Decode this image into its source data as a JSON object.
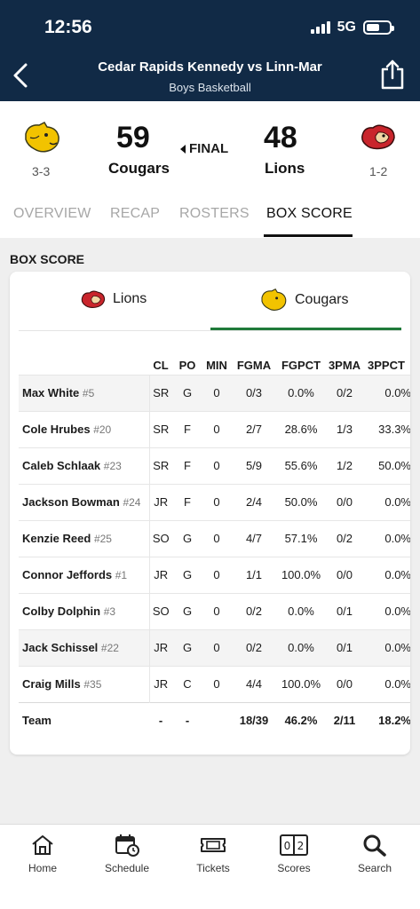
{
  "status_bar": {
    "time": "12:56",
    "network": "5G"
  },
  "header": {
    "title": "Cedar Rapids Kennedy vs Linn-Mar",
    "subtitle": "Boys Basketball"
  },
  "game": {
    "home": {
      "name": "Cougars",
      "score": "59",
      "record": "3-3"
    },
    "away": {
      "name": "Lions",
      "score": "48",
      "record": "1-2"
    },
    "status": "FINAL"
  },
  "tabs": [
    "OVERVIEW",
    "RECAP",
    "ROSTERS",
    "BOX SCORE"
  ],
  "box_score": {
    "section_title": "BOX SCORE",
    "team_tabs": [
      "Lions",
      "Cougars"
    ],
    "active_team": "Cougars",
    "columns": [
      "CL",
      "PO",
      "MIN",
      "FGMA",
      "FGPCT",
      "3PMA",
      "3PPCT"
    ],
    "players": [
      {
        "name": "Max White",
        "number": "#5",
        "cl": "SR",
        "po": "G",
        "min": "0",
        "fgma": "0/3",
        "fgpct": "0.0%",
        "tpma": "0/2",
        "tppct": "0.0%"
      },
      {
        "name": "Cole Hrubes",
        "number": "#20",
        "cl": "SR",
        "po": "F",
        "min": "0",
        "fgma": "2/7",
        "fgpct": "28.6%",
        "tpma": "1/3",
        "tppct": "33.3%"
      },
      {
        "name": "Caleb Schlaak",
        "number": "#23",
        "cl": "SR",
        "po": "F",
        "min": "0",
        "fgma": "5/9",
        "fgpct": "55.6%",
        "tpma": "1/2",
        "tppct": "50.0%"
      },
      {
        "name": "Jackson Bowman",
        "number": "#24",
        "cl": "JR",
        "po": "F",
        "min": "0",
        "fgma": "2/4",
        "fgpct": "50.0%",
        "tpma": "0/0",
        "tppct": "0.0%"
      },
      {
        "name": "Kenzie Reed",
        "number": "#25",
        "cl": "SO",
        "po": "G",
        "min": "0",
        "fgma": "4/7",
        "fgpct": "57.1%",
        "tpma": "0/2",
        "tppct": "0.0%"
      },
      {
        "name": "Connor Jeffords",
        "number": "#1",
        "cl": "JR",
        "po": "G",
        "min": "0",
        "fgma": "1/1",
        "fgpct": "100.0%",
        "tpma": "0/0",
        "tppct": "0.0%"
      },
      {
        "name": "Colby Dolphin",
        "number": "#3",
        "cl": "SO",
        "po": "G",
        "min": "0",
        "fgma": "0/2",
        "fgpct": "0.0%",
        "tpma": "0/1",
        "tppct": "0.0%"
      },
      {
        "name": "Jack Schissel",
        "number": "#22",
        "cl": "JR",
        "po": "G",
        "min": "0",
        "fgma": "0/2",
        "fgpct": "0.0%",
        "tpma": "0/1",
        "tppct": "0.0%"
      },
      {
        "name": "Craig Mills",
        "number": "#35",
        "cl": "JR",
        "po": "C",
        "min": "0",
        "fgma": "4/4",
        "fgpct": "100.0%",
        "tpma": "0/0",
        "tppct": "0.0%"
      }
    ],
    "team_row": {
      "label": "Team",
      "cl": "-",
      "po": "-",
      "min": "",
      "fgma": "18/39",
      "fgpct": "46.2%",
      "tpma": "2/11",
      "tppct": "18.2%"
    }
  },
  "bottom_nav": [
    {
      "label": "Home",
      "icon": "home-icon"
    },
    {
      "label": "Schedule",
      "icon": "calendar-icon"
    },
    {
      "label": "Tickets",
      "icon": "ticket-icon"
    },
    {
      "label": "Scores",
      "icon": "scoreboard-icon"
    },
    {
      "label": "Search",
      "icon": "search-icon"
    }
  ],
  "colors": {
    "header_bg": "#112a46",
    "active_tab_line": "#1f7a3a",
    "cougar_gold": "#f2c300",
    "lion_red": "#c9252c"
  }
}
